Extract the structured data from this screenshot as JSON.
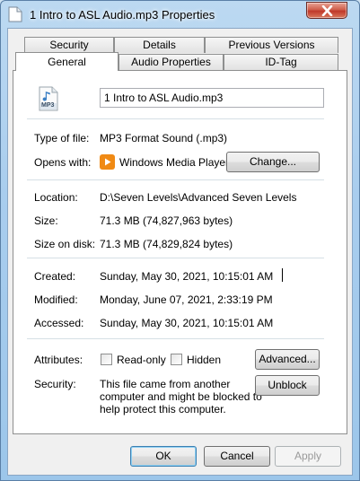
{
  "window": {
    "title": "1 Intro to ASL Audio.mp3 Properties"
  },
  "tabs": {
    "top_row": [
      "Security",
      "Details",
      "Previous Versions"
    ],
    "bottom_row": [
      "General",
      "Audio Properties",
      "ID-Tag"
    ],
    "active": "General"
  },
  "general": {
    "file_name": "1 Intro to ASL Audio.mp3",
    "file_icon_label": "MP3",
    "type_label": "Type of file:",
    "type_value": "MP3 Format Sound (.mp3)",
    "opens_label": "Opens with:",
    "opens_value": "Windows Media Player",
    "change_button": "Change...",
    "location_label": "Location:",
    "location_value": "D:\\Seven Levels\\Advanced Seven Levels",
    "size_label": "Size:",
    "size_value": "71.3 MB (74,827,963 bytes)",
    "size_on_disk_label": "Size on disk:",
    "size_on_disk_value": "71.3 MB (74,829,824 bytes)",
    "created_label": "Created:",
    "created_value": "Sunday, May 30, 2021, 10:15:01 AM",
    "modified_label": "Modified:",
    "modified_value": "Monday, June 07, 2021, 2:33:19 PM",
    "accessed_label": "Accessed:",
    "accessed_value": "Sunday, May 30, 2021, 10:15:01 AM",
    "attributes_label": "Attributes:",
    "readonly_label": "Read-only",
    "hidden_label": "Hidden",
    "advanced_button": "Advanced...",
    "security_label": "Security:",
    "security_text_1": "This file came from another",
    "security_text_2": "computer and might be blocked to",
    "security_text_3": "help protect this computer.",
    "unblock_button": "Unblock"
  },
  "footer": {
    "ok": "OK",
    "cancel": "Cancel",
    "apply": "Apply"
  },
  "colors": {
    "accent_blue": "#3c7fb1",
    "close_red": "#c0392b",
    "wmp_orange": "#f08a14"
  }
}
